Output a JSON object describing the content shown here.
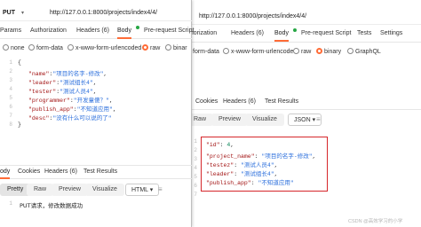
{
  "right": {
    "url": "http://127.0.0.1:8000/projects/index4/4/",
    "tabs": [
      "uthorization",
      "Headers (6)",
      "Body",
      "Pre-request Script",
      "Tests",
      "Settings"
    ],
    "body_options": [
      "form-data",
      "x-www-form-urlencoded",
      "raw",
      "binary",
      "GraphQL"
    ],
    "response_tabs": [
      "Cookies",
      "Headers (6)",
      "Test Results"
    ],
    "view_buttons": [
      "Raw",
      "Preview",
      "Visualize"
    ],
    "format": "JSON",
    "line_numbers": [
      "1",
      "2",
      "3",
      "4",
      "5",
      "6",
      "7"
    ],
    "json": {
      "id_key": "\"id\"",
      "id_val": "4",
      "project_key": "\"project_name\"",
      "project_val": "\"项目的名字-修改\"",
      "tester_key": "\"testez\"",
      "tester_val": "\"测试人员4\"",
      "leader_key": "\"leader\"",
      "leader_val": "\"测试组长4\"",
      "app_key": "\"publish_app\"",
      "app_val": "\"不知道应用\""
    }
  },
  "left": {
    "method": "PUT",
    "url": "http://127.0.0.1:8000/projects/index4/4/",
    "tabs": [
      "Params",
      "Authorization",
      "Headers (6)",
      "Body",
      "Pre-request Script"
    ],
    "body_options": [
      "none",
      "form-data",
      "x-www-form-urlencoded",
      "raw",
      "binar"
    ],
    "line_numbers": [
      "1",
      "2",
      "3",
      "4",
      "5",
      "6",
      "7",
      "8"
    ],
    "code": {
      "l1": "{",
      "name_key": "\"name\"",
      "name_val": "\"项目的名字-修改\"",
      "leader_key": "\"leader\"",
      "leader_val": "\"测试组长4\"",
      "tester_key": "\"tester\"",
      "tester_val": "\"测试人员4\"",
      "prog_key": "\"programmer\"",
      "prog_val": "\"开发童傻？\"",
      "app_key": "\"publish_app\"",
      "app_val": "\"不知道应用\"",
      "desc_key": "\"desc\"",
      "desc_val": "\"没有什么可以说的了\"",
      "l8": "}"
    },
    "response_tabs": [
      "ody",
      "Cookies",
      "Headers (6)",
      "Test Results"
    ],
    "view_buttons": [
      "Pretty",
      "Raw",
      "Preview",
      "Visualize"
    ],
    "format": "HTML",
    "response_line": "1",
    "response_text": "PUT请求，修改数据成功"
  },
  "watermark": "CSDN @高效学习的小学"
}
